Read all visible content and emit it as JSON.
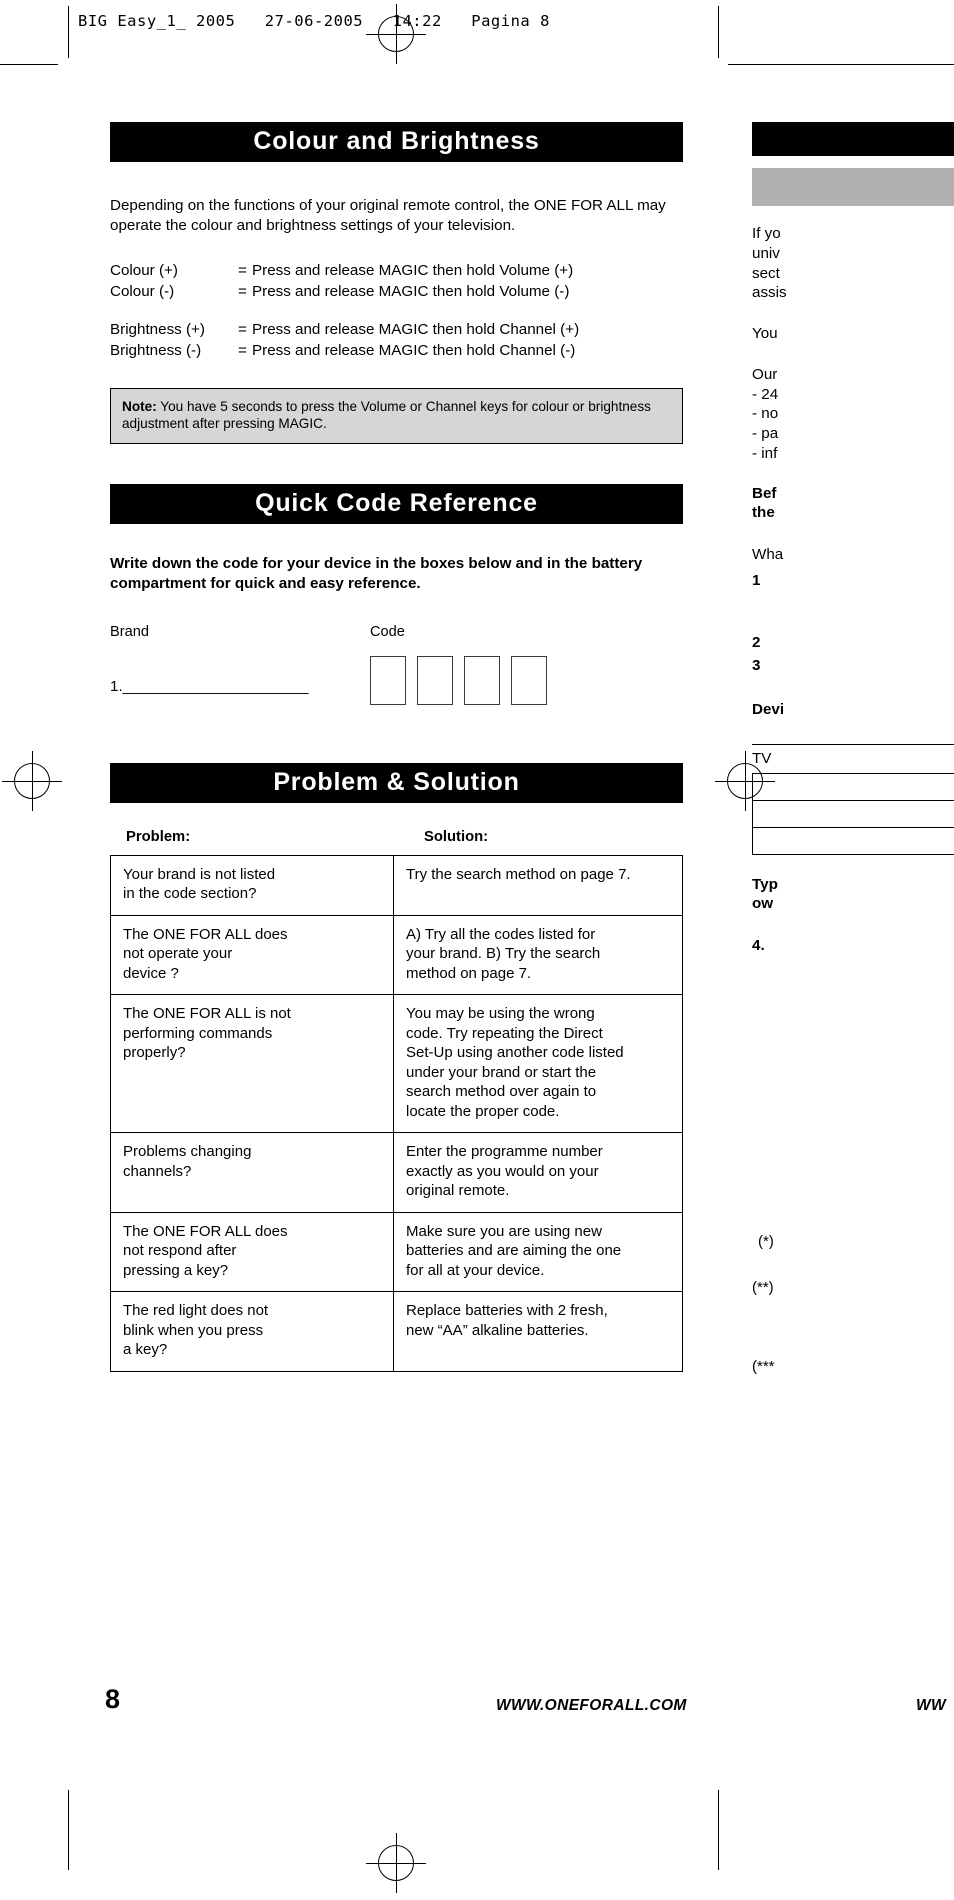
{
  "prepress": {
    "header": "BIG Easy_1_ 2005   27-06-2005   14:22   Pagina 8"
  },
  "sections": {
    "colour_brightness": {
      "title": "Colour and Brightness",
      "intro": "Depending on the functions of your original remote control, the ONE FOR ALL may operate the colour and brightness settings of your television.",
      "mappings": [
        {
          "label": "Colour (+)",
          "eq": "=",
          "action": "Press and release  MAGIC  then hold Volume (+)"
        },
        {
          "label": "Colour (-)",
          "eq": "=",
          "action": "Press and release  MAGIC  then hold Volume (-)"
        },
        {
          "label": "Brightness (+)",
          "eq": "=",
          "action": "Press and release  MAGIC  then hold Channel (+)"
        },
        {
          "label": "Brightness (-)",
          "eq": "=",
          "action": "Press and release  MAGIC  then hold Channel (-)"
        }
      ],
      "note_label": "Note:",
      "note_text": " You have 5 seconds to press the Volume or Channel keys for colour or brightness adjustment after pressing MAGIC."
    },
    "quick_code": {
      "title": "Quick Code Reference",
      "instruction": "Write down the code for your device in the boxes below and in the battery compartment for quick and easy reference.",
      "brand_heading": "Brand",
      "code_heading": "Code",
      "brand_row_label": "1.______________________",
      "code_box_count": 4
    },
    "problem_solution": {
      "title": "Problem & Solution",
      "col_problem": "Problem:",
      "col_solution": "Solution:",
      "rows": [
        {
          "problem": "Your brand is not listed\nin the code section?",
          "solution": "Try the search method on page 7."
        },
        {
          "problem": "The ONE FOR ALL does\nnot operate your\ndevice ?",
          "solution": "A) Try all the codes listed for\nyour brand. B) Try the search\nmethod on page 7."
        },
        {
          "problem": "The ONE FOR ALL is not\nperforming commands\nproperly?",
          "solution": "You may be using the wrong\ncode. Try repeating the Direct\nSet-Up using another code listed\nunder your brand or start the\nsearch method over again to\nlocate the proper code."
        },
        {
          "problem": "Problems changing\nchannels?",
          "solution": "Enter the programme number\nexactly as you would on your\noriginal remote."
        },
        {
          "problem": "The ONE FOR ALL does\nnot respond after\npressing a key?",
          "solution": "Make sure you are using new\nbatteries and are aiming the one\nfor all at your device."
        },
        {
          "problem": "The red light does not\nblink when you press\na key?",
          "solution": "Replace batteries with 2 fresh,\nnew “AA” alkaline batteries."
        }
      ]
    }
  },
  "footer": {
    "page_number": "8",
    "url_center": "WWW.ONEFORALL.COM",
    "url_right": "WW"
  },
  "right_page_clipped": {
    "lines": [
      "If yo",
      "univ",
      "sect",
      "assis"
    ],
    "you_line": "You",
    "our_line": "Our",
    "bullets": [
      "- 24",
      "- no",
      "- pa",
      "- inf"
    ],
    "before_bold": [
      "Bef",
      "the"
    ],
    "what_line": "Wha",
    "steps": [
      "1",
      "2",
      "3"
    ],
    "device_bold": "Devi",
    "table_first_row": "TV",
    "typ_bold": [
      "Typ",
      "ow"
    ],
    "step4": "4.",
    "footnotes": [
      "(*)",
      "(**)",
      "(***"
    ]
  },
  "colors": {
    "banner_bg": "#000000",
    "banner_fg": "#ffffff",
    "note_bg": "#d6d6d6",
    "grey_block": "#b0b0b0",
    "rule": "#000000"
  }
}
